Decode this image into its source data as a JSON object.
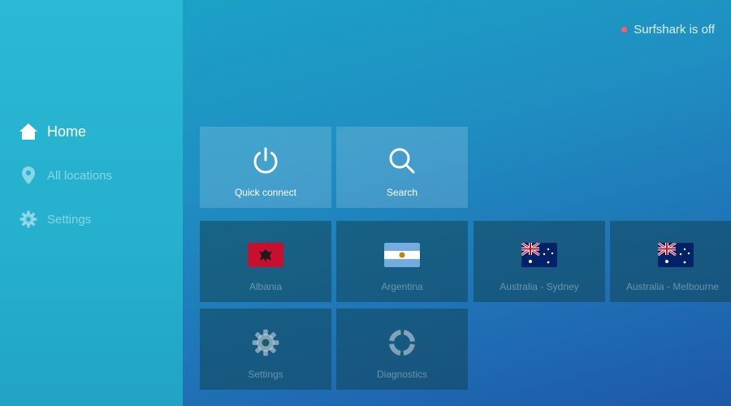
{
  "status": {
    "text": "Surfshark is off",
    "dot_color": "#ff5a6e"
  },
  "sidebar": {
    "items": [
      {
        "label": "Home",
        "icon": "home-icon",
        "active": true
      },
      {
        "label": "All locations",
        "icon": "location-pin-icon",
        "active": false
      },
      {
        "label": "Settings",
        "icon": "gear-icon",
        "active": false
      }
    ]
  },
  "tiles": {
    "quick_connect": {
      "label": "Quick connect",
      "icon": "power-icon"
    },
    "search": {
      "label": "Search",
      "icon": "search-icon"
    },
    "locations": [
      {
        "label": "Albania",
        "icon": "flag-albania-icon"
      },
      {
        "label": "Argentina",
        "icon": "flag-argentina-icon"
      },
      {
        "label": "Australia - Sydney",
        "icon": "flag-australia-icon"
      },
      {
        "label": "Australia - Melbourne",
        "icon": "flag-australia-icon"
      }
    ],
    "settings": {
      "label": "Settings",
      "icon": "gear-icon"
    },
    "diagnostics": {
      "label": "Diagnostics",
      "icon": "lifebuoy-icon"
    }
  },
  "colors": {
    "background_top": "#1aa6c8",
    "background_bottom": "#1e58a8",
    "sidebar": "#25b0cd"
  }
}
